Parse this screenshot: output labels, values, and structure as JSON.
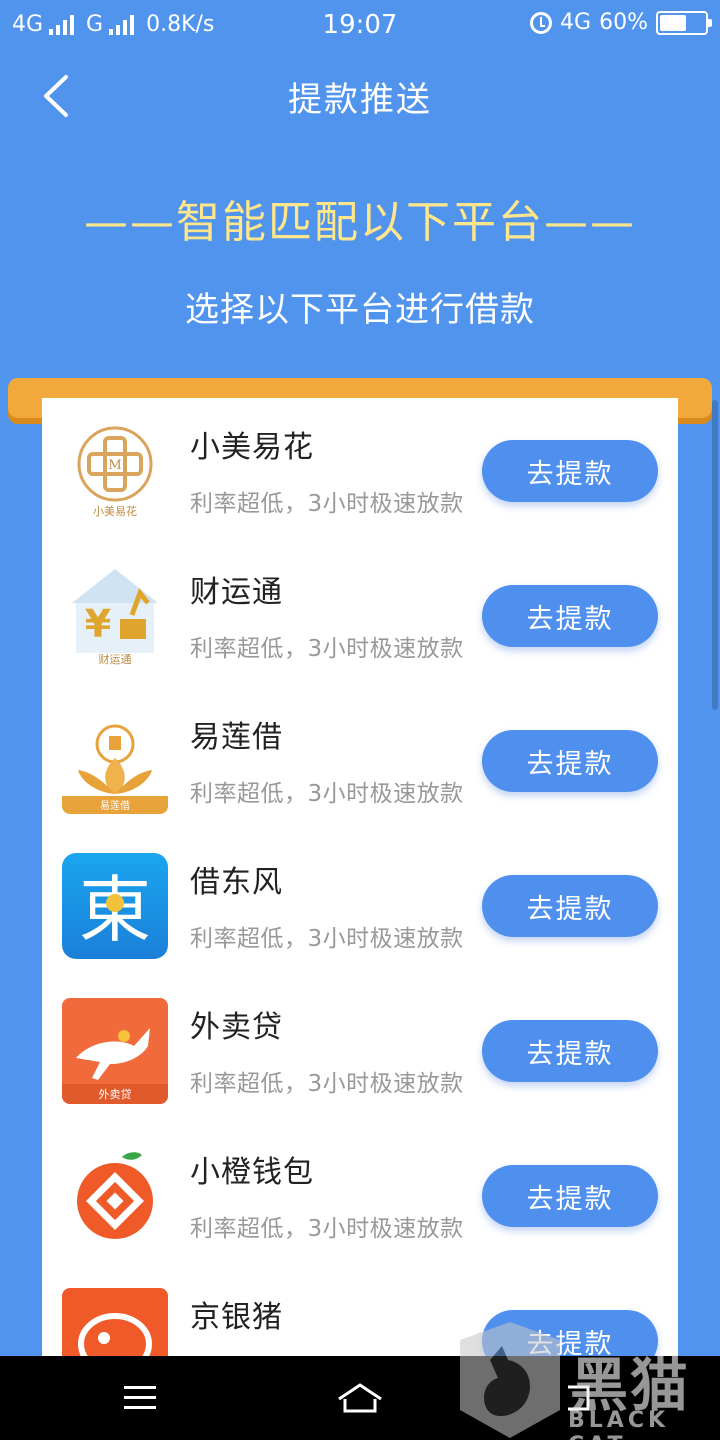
{
  "status_bar": {
    "net1": "4G",
    "net2": "G",
    "speed": "0.8K/s",
    "time": "19:07",
    "net3": "4G",
    "battery": "60%",
    "battery_level": 0.6
  },
  "nav": {
    "title": "提款推送",
    "back_icon": "chevron-left-icon"
  },
  "banner": {
    "title": "——智能匹配以下平台——",
    "subtitle": "选择以下平台进行借款"
  },
  "platforms": [
    {
      "name": "小美易花",
      "desc": "利率超低，3小时极速放款",
      "button": "去提款",
      "logo_text": "小美易花"
    },
    {
      "name": "财运通",
      "desc": "利率超低，3小时极速放款",
      "button": "去提款",
      "logo_text": "财运通"
    },
    {
      "name": "易莲借",
      "desc": "利率超低，3小时极速放款",
      "button": "去提款",
      "logo_text": "易莲借"
    },
    {
      "name": "借东风",
      "desc": "利率超低，3小时极速放款",
      "button": "去提款",
      "logo_text": "東"
    },
    {
      "name": "外卖贷",
      "desc": "利率超低，3小时极速放款",
      "button": "去提款",
      "logo_text": "外卖贷"
    },
    {
      "name": "小橙钱包",
      "desc": "利率超低，3小时极速放款",
      "button": "去提款",
      "logo_text": ""
    },
    {
      "name": "京银猪",
      "desc": "",
      "button": "去提款",
      "logo_text": ""
    }
  ],
  "watermark": {
    "text": "黑猫",
    "sub": "BLACK CAT"
  },
  "colors": {
    "background": "#5194ee",
    "accent": "#4f8fee",
    "gold": "#ffe68a",
    "scroll_bar": "#f0a93a"
  }
}
